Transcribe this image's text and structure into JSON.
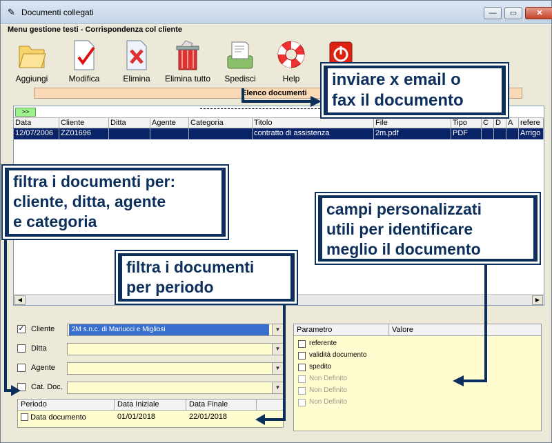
{
  "window": {
    "title": "Documenti collegati",
    "minimize": "—",
    "maximize": "▭",
    "close": "✕"
  },
  "menu": {
    "title": "Menu gestione testi - Corrispondenza col cliente"
  },
  "toolbar": {
    "items": [
      {
        "label": "Aggiungi"
      },
      {
        "label": "Modifica"
      },
      {
        "label": "Elimina"
      },
      {
        "label": "Elimina tutto"
      },
      {
        "label": "Spedisci"
      },
      {
        "label": "Help"
      },
      {
        "label": ""
      }
    ]
  },
  "list": {
    "section_title": "Elenco documenti",
    "expand_label": ">>",
    "columns": [
      "Data",
      "Cliente",
      "Ditta",
      "Agente",
      "Categoria",
      "Titolo",
      "File",
      "Tipo",
      "C",
      "D",
      "A",
      "refere"
    ],
    "rows": [
      [
        "12/07/2006",
        "ZZ01696",
        "",
        "",
        "",
        "contratto di assistenza",
        "2m.pdf",
        "PDF",
        "",
        "",
        "",
        "Arrigo"
      ]
    ]
  },
  "filters": {
    "cliente": {
      "label": "Cliente",
      "checked": true,
      "value": "2M s.n.c. di Mariucci e Migliosi"
    },
    "ditta": {
      "label": "Ditta",
      "checked": false,
      "value": ""
    },
    "agente": {
      "label": "Agente",
      "checked": false,
      "value": ""
    },
    "cat_doc": {
      "label": "Cat. Doc.",
      "checked": false,
      "value": ""
    }
  },
  "period_table": {
    "columns": [
      "Periodo",
      "Data Iniziale",
      "Data Finale"
    ],
    "row": {
      "periodo": "Data documento",
      "data_iniziale": "01/01/2018",
      "data_finale": "22/01/2018"
    }
  },
  "params_table": {
    "columns": [
      "Parametro",
      "Valore"
    ],
    "rows": [
      {
        "label": "referente",
        "enabled": true
      },
      {
        "label": "validità documento",
        "enabled": true
      },
      {
        "label": "spedito",
        "enabled": true
      },
      {
        "label": "Non Definito",
        "enabled": false
      },
      {
        "label": "Non Definito",
        "enabled": false
      },
      {
        "label": "Non Definito",
        "enabled": false
      }
    ]
  },
  "callouts": {
    "email": [
      "inviare x email o",
      "fax il documento"
    ],
    "filters": [
      "filtra i documenti per:",
      "cliente, ditta, agente",
      "e categoria"
    ],
    "period": [
      "filtra i documenti",
      "per periodo"
    ],
    "custom": [
      "campi personalizzati",
      "utili per identificare",
      "meglio il documento"
    ]
  },
  "colors": {
    "callout": "#0c2f5c",
    "selection": "#0a246a",
    "input_bg": "#fffcd0",
    "section_bar": "#fbd8b6"
  }
}
